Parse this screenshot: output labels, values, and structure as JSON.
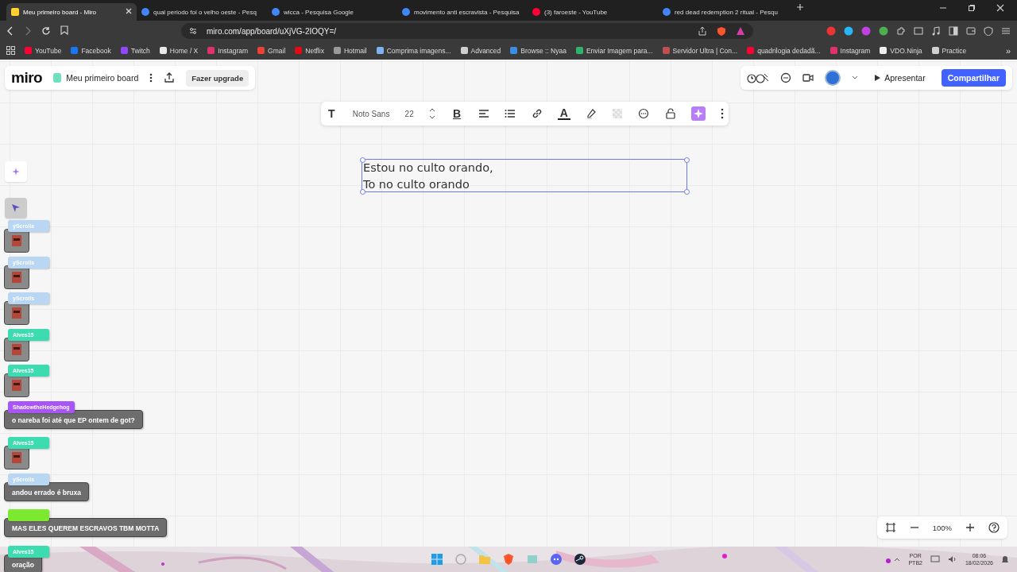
{
  "browser": {
    "tabs": [
      {
        "title": "Meu primeiro board - Miro",
        "selected": true,
        "color": "#ffd02f"
      },
      {
        "title": "qual periodo foi o velho oeste - Pesq",
        "selected": false,
        "color": "#4285f4"
      },
      {
        "title": "wicca - Pesquisa Google",
        "selected": false,
        "color": "#4285f4"
      },
      {
        "title": "movimento anti escravista - Pesquisa",
        "selected": false,
        "color": "#4285f4"
      },
      {
        "title": "(3) faroeste - YouTube",
        "selected": false,
        "color": "#ff0033"
      },
      {
        "title": "red dead redemption 2 ritual - Pesqu",
        "selected": false,
        "color": "#4285f4"
      }
    ],
    "url": "miro.com/app/board/uXjVG-2IOQY=/",
    "bookmarks": [
      {
        "label": "YouTube",
        "color": "#ff0033"
      },
      {
        "label": "Facebook",
        "color": "#1877f2"
      },
      {
        "label": "Twitch",
        "color": "#9146ff"
      },
      {
        "label": "Home / X",
        "color": "#e8e8e8"
      },
      {
        "label": "Instagram",
        "color": "#e1306c"
      },
      {
        "label": "Gmail",
        "color": "#ea4335"
      },
      {
        "label": "Netflix",
        "color": "#e50914"
      },
      {
        "label": "Hotmail",
        "color": "#9a9a9a"
      },
      {
        "label": "Comprima imagens...",
        "color": "#7fb2f0"
      },
      {
        "label": "Advanced",
        "color": "#cfcfcf"
      },
      {
        "label": "Browse :: Nyaa",
        "color": "#3a8ee6"
      },
      {
        "label": "Enviar Imagem para...",
        "color": "#2fb36b"
      },
      {
        "label": "Servidor Ultra | Con...",
        "color": "#c05050"
      },
      {
        "label": "quadrilogia dedadã...",
        "color": "#ff0033"
      },
      {
        "label": "Instagram",
        "color": "#e1306c"
      },
      {
        "label": "VDO.Ninja",
        "color": "#eeeeee"
      },
      {
        "label": "Practice",
        "color": "#d0d0d0"
      }
    ],
    "more": "»"
  },
  "board": {
    "logo": "miro",
    "name": "Meu primeiro board",
    "upgrade": "Fazer upgrade",
    "present": "Apresentar",
    "share": "Compartilhar",
    "toolbar": {
      "text_tool": "T",
      "font": "Noto Sans",
      "size": "22",
      "bold": "B",
      "color_tool": "A"
    },
    "text_lines": [
      "Estou no culto orando,",
      "To no culto orando"
    ],
    "zoom": "100%"
  },
  "chat": [
    {
      "kind": "sticker",
      "user": "yScrolls",
      "color": "#b9d6f2"
    },
    {
      "kind": "sticker",
      "user": "yScrolls",
      "color": "#b9d6f2"
    },
    {
      "kind": "sticker",
      "user": "yScrolls",
      "color": "#b9d6f2"
    },
    {
      "kind": "sticker",
      "user": "Alves15",
      "color": "#3ddbb0"
    },
    {
      "kind": "sticker",
      "user": "Alves15",
      "color": "#3ddbb0"
    },
    {
      "kind": "text",
      "user": "ShadowtheHedgehog",
      "color": "#a855f7",
      "message": "o nareba foi até que EP ontem de got?"
    },
    {
      "kind": "sticker",
      "user": "Alves15",
      "color": "#3ddbb0"
    },
    {
      "kind": "text",
      "user": "yScrolls",
      "color": "#b9d6f2",
      "message": "andou errado é bruxa"
    },
    {
      "kind": "text",
      "color": "#7ce830",
      "message": "MAS ELES QUEREM ESCRAVOS TBM MOTTA"
    },
    {
      "kind": "text",
      "user": "Alves15",
      "color": "#3ddbb0",
      "message": "oração"
    }
  ],
  "taskbar": {
    "lang": "POR",
    "layout": "PTB2",
    "time": "08:06",
    "date": "18/02/2026"
  }
}
